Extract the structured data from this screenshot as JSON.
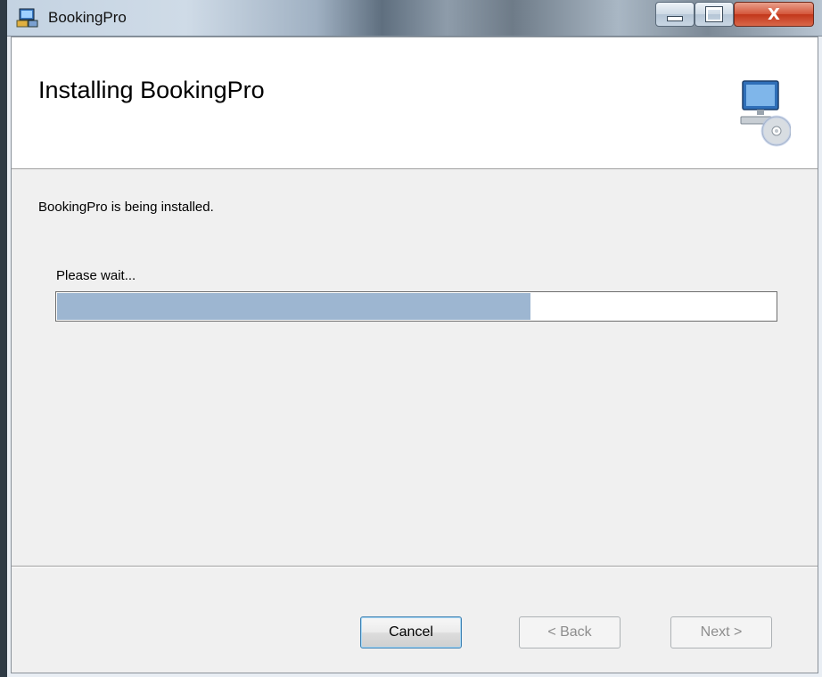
{
  "window": {
    "title": "BookingPro",
    "controls": {
      "minimize": "minimize",
      "maximize": "maximize",
      "close": "X"
    }
  },
  "banner": {
    "title": "Installing BookingPro",
    "icon": "setup-computer-cd-icon"
  },
  "content": {
    "description": "BookingPro is being installed.",
    "progress_label": "Please wait...",
    "progress_percent": 66
  },
  "buttons": {
    "cancel": "Cancel",
    "back": "< Back",
    "next": "Next >"
  },
  "colors": {
    "progress_fill": "#9db6d1",
    "close_button": "#c2361a"
  }
}
